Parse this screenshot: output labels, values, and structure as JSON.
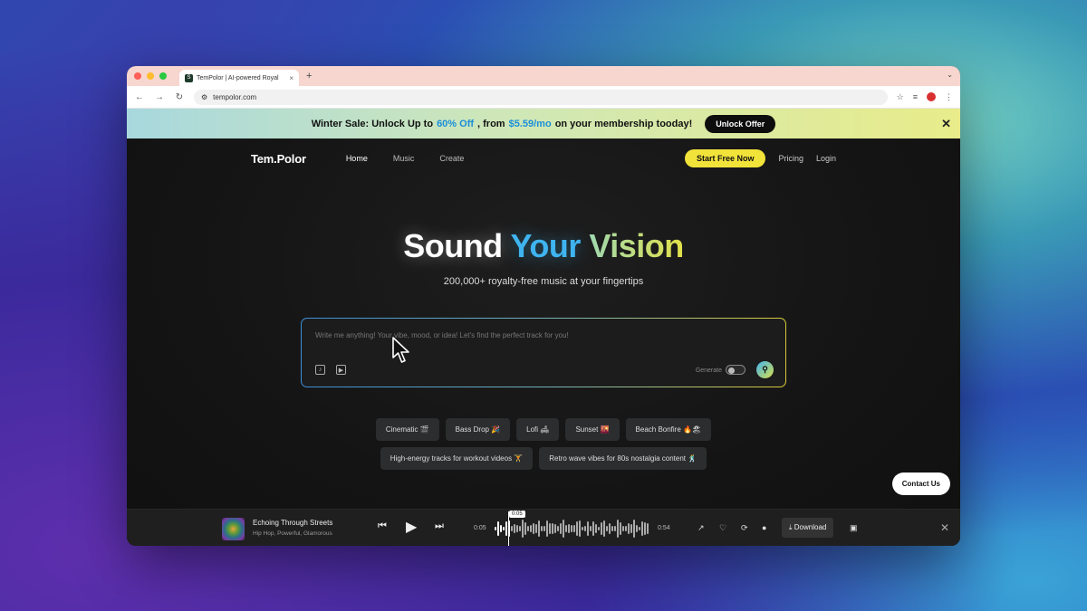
{
  "browser": {
    "tab_title": "TemPolor | AI-powered Royal",
    "url": "tempolor.com",
    "new_tab": "+",
    "tab_close": "×"
  },
  "banner": {
    "text_before": "Winter Sale: Unlock Up to",
    "discount": "60% Off",
    "text_middle": ", from",
    "price": "$5.59/mo",
    "text_after": "on your membership tooday!",
    "button": "Unlock Offer"
  },
  "nav": {
    "logo": "Tem.Polor",
    "links": [
      "Home",
      "Music",
      "Create"
    ],
    "cta": "Start Free Now",
    "pricing": "Pricing",
    "login": "Login"
  },
  "hero": {
    "title_1": "Sound",
    "title_2": "Your",
    "title_3": "Vision",
    "subtitle": "200,000+ royalty-free music at your fingertips"
  },
  "prompt": {
    "placeholder": "Write me anything! Your vibe, mood, or idea! Let's find the perfect track for you!",
    "generate_label": "Generate"
  },
  "chips": {
    "row1": [
      "Cinematic 🎬",
      "Bass Drop 🎉",
      "Lofi 🛋",
      "Sunset 🌇",
      "Beach Bonfire 🔥🏖"
    ],
    "row2": [
      "High-energy tracks for workout videos 🏋",
      "Retro wave vibes for 80s nostalgia content 🕺"
    ]
  },
  "contact": "Contact Us",
  "player": {
    "title": "Echoing Through Streets",
    "tags": "Hip Hop, Powerful, Glamorous",
    "current": "0:05",
    "playhead_label": "0:05",
    "duration": "0:54",
    "download": "Download",
    "progress": 0.09
  },
  "colors": {
    "accent_yellow": "#f2e33a",
    "accent_blue": "#3fb4f0"
  }
}
